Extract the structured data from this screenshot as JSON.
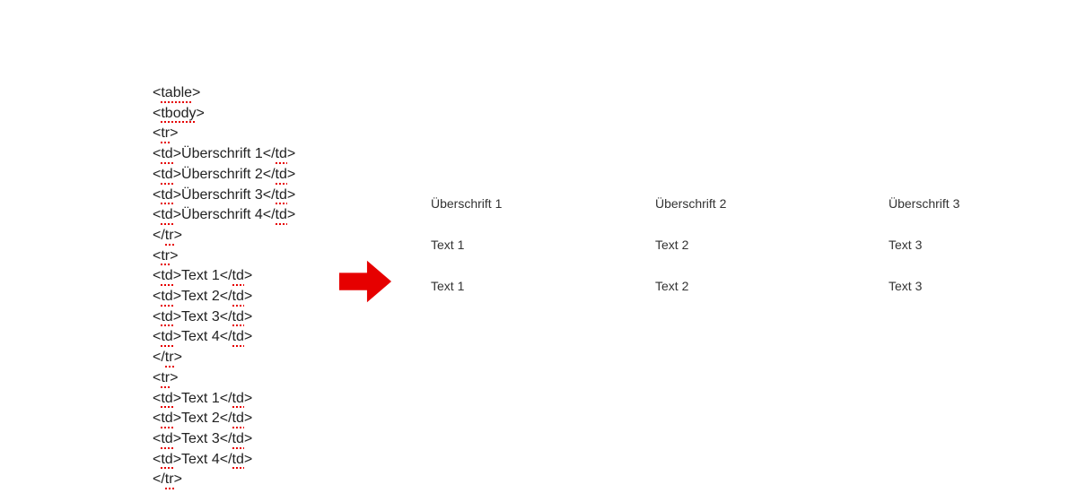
{
  "code_lines": [
    {
      "segments": [
        {
          "t": "<"
        },
        {
          "t": "table",
          "u": true
        },
        {
          "t": ">"
        }
      ]
    },
    {
      "segments": [
        {
          "t": "<"
        },
        {
          "t": "tbody",
          "u": true
        },
        {
          "t": ">"
        }
      ]
    },
    {
      "segments": [
        {
          "t": "<"
        },
        {
          "t": "tr",
          "u": true
        },
        {
          "t": ">"
        }
      ]
    },
    {
      "segments": [
        {
          "t": "<"
        },
        {
          "t": "td",
          "u": true
        },
        {
          "t": ">Überschrift 1</"
        },
        {
          "t": "td",
          "u": true
        },
        {
          "t": ">"
        }
      ]
    },
    {
      "segments": [
        {
          "t": "<"
        },
        {
          "t": "td",
          "u": true
        },
        {
          "t": ">Überschrift 2</"
        },
        {
          "t": "td",
          "u": true
        },
        {
          "t": ">"
        }
      ]
    },
    {
      "segments": [
        {
          "t": "<"
        },
        {
          "t": "td",
          "u": true
        },
        {
          "t": ">Überschrift 3</"
        },
        {
          "t": "td",
          "u": true
        },
        {
          "t": ">"
        }
      ]
    },
    {
      "segments": [
        {
          "t": "<"
        },
        {
          "t": "td",
          "u": true
        },
        {
          "t": ">Überschrift 4</"
        },
        {
          "t": "td",
          "u": true
        },
        {
          "t": ">"
        }
      ]
    },
    {
      "segments": [
        {
          "t": "</"
        },
        {
          "t": "tr",
          "u": true
        },
        {
          "t": ">"
        }
      ]
    },
    {
      "segments": [
        {
          "t": "<"
        },
        {
          "t": "tr",
          "u": true
        },
        {
          "t": ">"
        }
      ]
    },
    {
      "segments": [
        {
          "t": "<"
        },
        {
          "t": "td",
          "u": true
        },
        {
          "t": ">Text 1</"
        },
        {
          "t": "td",
          "u": true
        },
        {
          "t": ">"
        }
      ]
    },
    {
      "segments": [
        {
          "t": "<"
        },
        {
          "t": "td",
          "u": true
        },
        {
          "t": ">Text 2</"
        },
        {
          "t": "td",
          "u": true
        },
        {
          "t": ">"
        }
      ]
    },
    {
      "segments": [
        {
          "t": "<"
        },
        {
          "t": "td",
          "u": true
        },
        {
          "t": ">Text 3</"
        },
        {
          "t": "td",
          "u": true
        },
        {
          "t": ">"
        }
      ]
    },
    {
      "segments": [
        {
          "t": "<"
        },
        {
          "t": "td",
          "u": true
        },
        {
          "t": ">Text 4</"
        },
        {
          "t": "td",
          "u": true
        },
        {
          "t": ">"
        }
      ]
    },
    {
      "segments": [
        {
          "t": "</"
        },
        {
          "t": "tr",
          "u": true
        },
        {
          "t": ">"
        }
      ]
    },
    {
      "segments": [
        {
          "t": "<"
        },
        {
          "t": "tr",
          "u": true
        },
        {
          "t": ">"
        }
      ]
    },
    {
      "segments": [
        {
          "t": "<"
        },
        {
          "t": "td",
          "u": true
        },
        {
          "t": ">Text 1</"
        },
        {
          "t": "td",
          "u": true
        },
        {
          "t": ">"
        }
      ]
    },
    {
      "segments": [
        {
          "t": "<"
        },
        {
          "t": "td",
          "u": true
        },
        {
          "t": ">Text 2</"
        },
        {
          "t": "td",
          "u": true
        },
        {
          "t": ">"
        }
      ]
    },
    {
      "segments": [
        {
          "t": "<"
        },
        {
          "t": "td",
          "u": true
        },
        {
          "t": ">Text 3</"
        },
        {
          "t": "td",
          "u": true
        },
        {
          "t": ">"
        }
      ]
    },
    {
      "segments": [
        {
          "t": "<"
        },
        {
          "t": "td",
          "u": true
        },
        {
          "t": ">Text 4</"
        },
        {
          "t": "td",
          "u": true
        },
        {
          "t": ">"
        }
      ]
    },
    {
      "segments": [
        {
          "t": "</"
        },
        {
          "t": "tr",
          "u": true
        },
        {
          "t": ">"
        }
      ]
    }
  ],
  "rendered_table": {
    "rows": [
      [
        "Überschrift 1",
        "Überschrift 2",
        "Überschrift 3"
      ],
      [
        "Text 1",
        "Text 2",
        "Text 3"
      ],
      [
        "Text 1",
        "Text 2",
        "Text 3"
      ]
    ]
  },
  "colors": {
    "arrow": "#e60000"
  }
}
